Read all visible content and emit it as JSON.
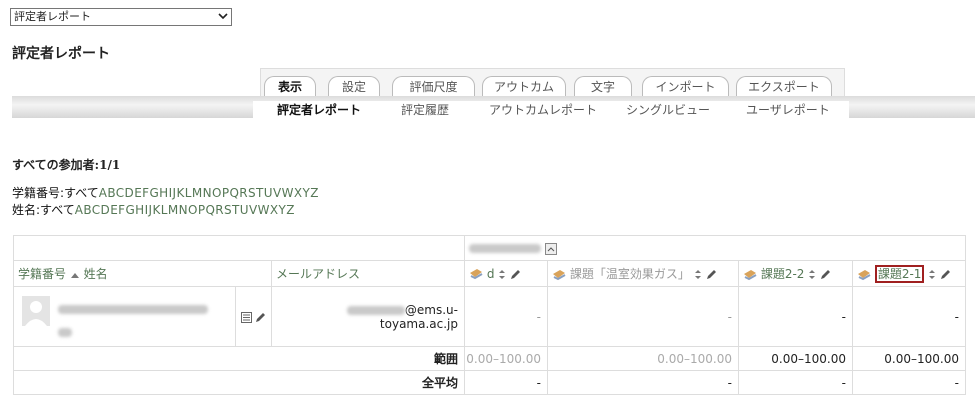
{
  "report_select": {
    "value": "評定者レポート"
  },
  "page_title": "評定者レポート",
  "tabs": [
    "表示",
    "設定",
    "評価尺度",
    "アウトカム",
    "文字",
    "インポート",
    "エクスポート"
  ],
  "subtabs": [
    "評定者レポート",
    "評定履歴",
    "アウトカムレポート",
    "シングルビュー",
    "ユーザレポート"
  ],
  "participants": "すべての参加者:1/1",
  "filters": {
    "student_id_label": "学籍番号",
    "name_label": "姓名",
    "all": ":すべて",
    "letters": "ABCDEFGHIJKLMNOPQRSTUVWXYZ"
  },
  "table": {
    "headers": {
      "student_id": "学籍番号",
      "name": "姓名",
      "email": "メールアドレス",
      "items": [
        "d",
        "課題「温室効果ガス」",
        "課題2-2",
        "課題2-1"
      ]
    },
    "row": {
      "email_domain": "@ems.u-toyama.ac.jp",
      "grades": [
        "-",
        "-",
        "-",
        "-"
      ]
    },
    "range_label": "範囲",
    "ranges": [
      "0.00–100.00",
      "0.00–100.00",
      "0.00–100.00",
      "0.00–100.00"
    ],
    "average_label": "全平均",
    "averages": [
      "-",
      "-",
      "-",
      "-"
    ]
  },
  "colors": {
    "link": "#557755",
    "highlight_border": "#a02020"
  }
}
